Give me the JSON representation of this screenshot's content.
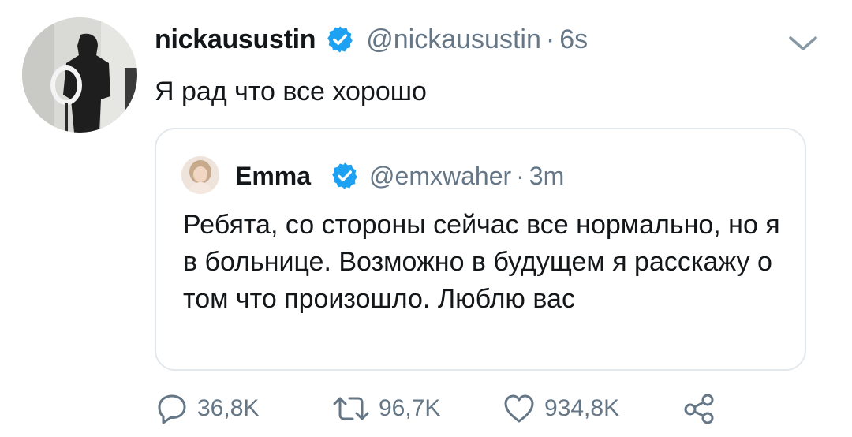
{
  "tweet": {
    "display_name": "nickausustin",
    "handle": "@nickausustin",
    "separator": "·",
    "time": "6s",
    "text": "Я рад что все хорошо",
    "verified": true,
    "avatar_icon": "profile-photo",
    "menu_icon": "chevron-down-icon"
  },
  "quoted_tweet": {
    "display_name": "Emma",
    "handle": "@emxwaher",
    "separator": "·",
    "time": "3m",
    "text": "Ребята, со стороны сейчас все нормально, но я в больнице. Возможно в будущем я расскажу о том что произошло. Люблю вас",
    "verified": true
  },
  "actions": {
    "reply": {
      "icon": "reply-icon",
      "count": "36,8K"
    },
    "retweet": {
      "icon": "retweet-icon",
      "count": "96,7K"
    },
    "like": {
      "icon": "heart-icon",
      "count": "934,8K"
    },
    "share": {
      "icon": "share-icon"
    }
  },
  "colors": {
    "verified_blue": "#1da1f2",
    "secondary_text": "#657786",
    "primary_text": "#14171a",
    "border": "#e3e8ec"
  }
}
